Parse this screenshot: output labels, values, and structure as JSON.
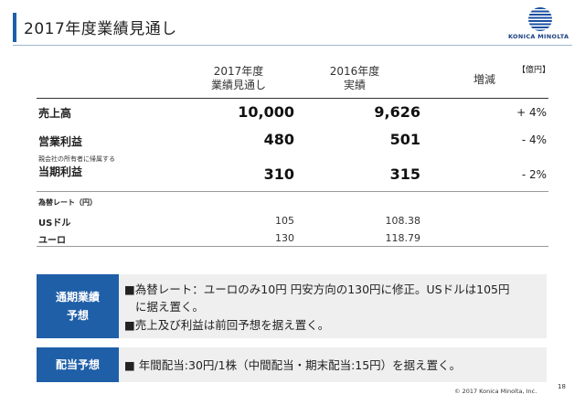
{
  "header": {
    "title": "2017年度業績見通し",
    "logo_text": "KONICA MINOLTA"
  },
  "table": {
    "unit": "【億円】",
    "col_2017": [
      "2017年度",
      "業績見通し"
    ],
    "col_2016": [
      "2016年度",
      "実績"
    ],
    "col_change": "増減",
    "rows": [
      {
        "label": "売上高",
        "v2017": "10,000",
        "v2016": "9,626",
        "change": "+ 4%"
      },
      {
        "label": "営業利益",
        "v2017": "480",
        "v2016": "501",
        "change": "- 4%"
      },
      {
        "sublabel": "親会社の所有者に帰属する",
        "label": "当期利益",
        "v2017": "310",
        "v2016": "315",
        "change": "- 2%"
      }
    ],
    "fx": {
      "heading": "為替レート（円）",
      "rows": [
        {
          "label": "USドル",
          "v2017": "105",
          "v2016": "108.38"
        },
        {
          "label": "ユーロ",
          "v2017": "130",
          "v2016": "118.79"
        }
      ]
    }
  },
  "forecast_box": {
    "label_line1": "通期業績",
    "label_line2": "予想",
    "bullets": [
      "■為替レート：ユーロのみ10円 円安方向の130円に修正。USドルは105円",
      "に据え置く。",
      "■売上及び利益は前回予想を据え置く。"
    ]
  },
  "dividend_box": {
    "label": "配当予想",
    "text": "■ 年間配当:30円/1株（中間配当・期末配当:15円）を据え置く。"
  },
  "footer": {
    "copyright": "© 2017 Konica Minolta, Inc.",
    "page": "18"
  },
  "colors": {
    "accent": "#1f5fa8",
    "box_bg": "#efefef"
  }
}
